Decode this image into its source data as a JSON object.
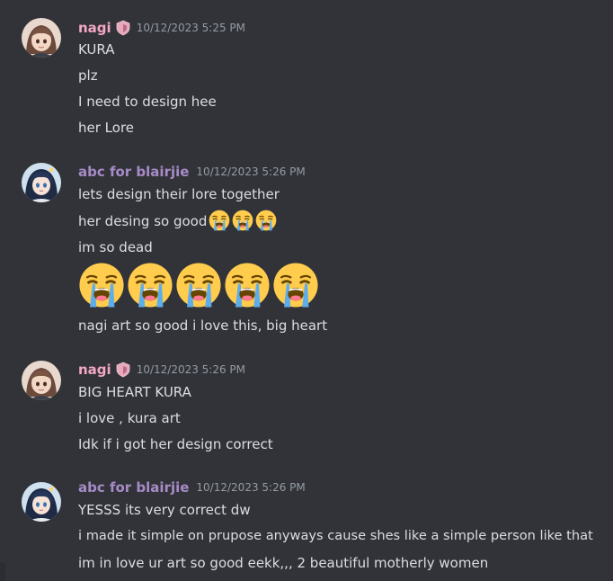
{
  "colors": {
    "background": "#313338",
    "text": "#dbdee1",
    "timestamp": "#949ba4",
    "nagi_name": "#f3a7c2",
    "abc_name": "#a78bc7"
  },
  "icons": {
    "role_badge": "shield-heart-icon",
    "emoji": "loudly-crying-face"
  },
  "messages": [
    {
      "author": "nagi",
      "timestamp": "10/12/2023 5:25 PM",
      "lines": [
        "KURA",
        "plz",
        "I need to design hee",
        "her Lore"
      ]
    },
    {
      "author": "abc for blairjie",
      "timestamp": "10/12/2023 5:26 PM",
      "lines": [
        "lets design their lore together",
        "her desing so good",
        "im so dead",
        "nagi art so good i love this, big heart"
      ]
    },
    {
      "author": "nagi",
      "timestamp": "10/12/2023 5:26 PM",
      "lines": [
        "BIG HEART KURA",
        "i love , kura art",
        "Idk if i got her design correct"
      ]
    },
    {
      "author": "abc for blairjie",
      "timestamp": "10/12/2023 5:26 PM",
      "lines": [
        "YESSS its very correct dw",
        "i made it simple on prupose anyways cause shes like a simple person like that",
        "im in love ur art so good eekk,,, 2 beautiful motherly women"
      ]
    }
  ]
}
